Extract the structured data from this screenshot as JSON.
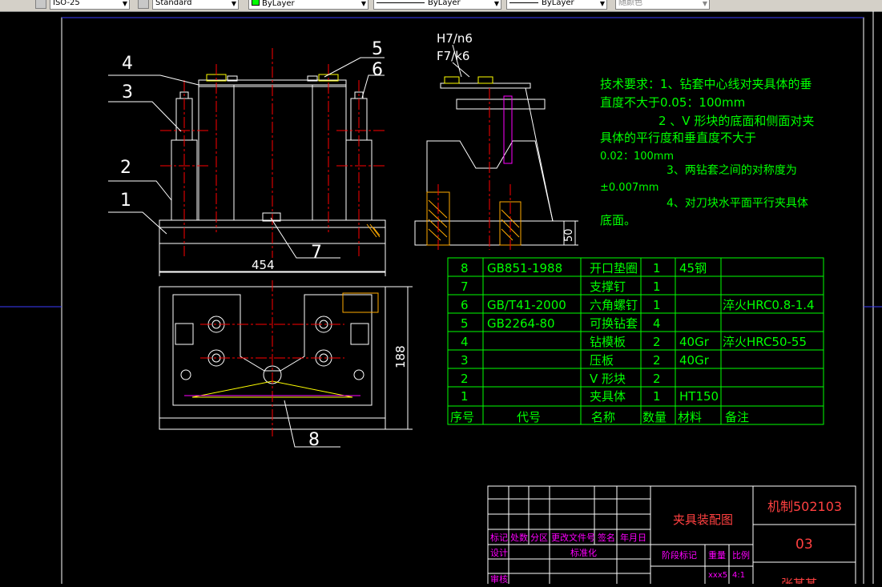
{
  "toolbar": {
    "dimstyle": "ISO-25",
    "tablestyle": "Standard",
    "layer_color": "ByLayer",
    "linetype": "ByLayer",
    "lineweight": "ByLayer",
    "plotstyle": "随颜色"
  },
  "drawing": {
    "front_view": {
      "callouts": [
        "4",
        "3",
        "2",
        "1",
        "7"
      ],
      "dimension_width": "454"
    },
    "side_view": {
      "fit_upper": "H7/n6",
      "fit_lower": "F7/k6",
      "callouts": [
        "5",
        "6"
      ],
      "dimension_height": "50"
    },
    "top_view": {
      "callout": "8",
      "dimension_height": "188"
    },
    "technical_requirements": [
      "技术要求：1、钻套中心线对夹具体的垂",
      "直度不大于0.05：100mm",
      "2 、V 形块的底面和侧面对夹",
      "具体的平行度和垂直度不大于",
      "0.02：100mm",
      "3、两钻套之间的对称度为",
      "±0.007mm",
      "4、对刀块水平面平行夹具体",
      "底面。"
    ],
    "parts_list": {
      "headers": [
        "序号",
        "代号",
        "名称",
        "数量",
        "材料",
        "备注"
      ],
      "rows": [
        [
          "8",
          "GB851-1988",
          "开口垫圈",
          "1",
          "45钢",
          ""
        ],
        [
          "7",
          "",
          "支撑钉",
          "1",
          "",
          ""
        ],
        [
          "6",
          "GB/T41-2000",
          "六角螺钉",
          "1",
          "",
          "淬火HRC0.8-1.4"
        ],
        [
          "5",
          "GB2264-80",
          "可换钻套",
          "4",
          "",
          ""
        ],
        [
          "4",
          "",
          "钻模板",
          "2",
          "40Gr",
          "淬火HRC50-55"
        ],
        [
          "3",
          "",
          "压板",
          "2",
          "40Gr",
          ""
        ],
        [
          "2",
          "",
          "V 形块",
          "2",
          "",
          ""
        ],
        [
          "1",
          "",
          "夹具体",
          "1",
          "HT150",
          ""
        ]
      ]
    },
    "title_block": {
      "drawing_name": "夹具装配图",
      "drawing_number": "机制502103",
      "sheet": "03",
      "bottom_right": "张某某",
      "labels": {
        "mark": "标记",
        "count": "处数",
        "zone": "分区",
        "change_doc": "更改文件号",
        "signature": "签名",
        "date": "年月日",
        "design": "设计",
        "standardize": "标准化",
        "review": "审核",
        "stage_mark": "阶段标记",
        "weight": "重量",
        "scale": "比例",
        "weight_value": "xxx5",
        "scale_value": "4:1"
      }
    }
  }
}
